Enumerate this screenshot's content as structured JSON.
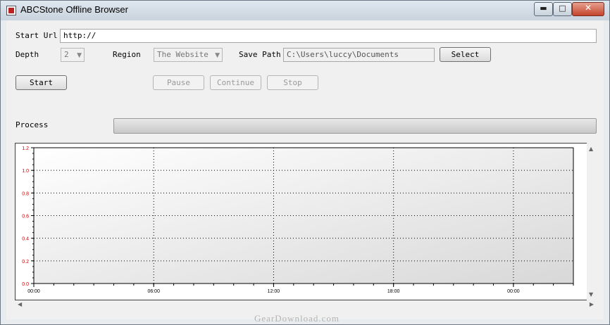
{
  "window": {
    "title": "ABCStone Offline Browser",
    "minimize": "▬",
    "maximize": "□",
    "close": "✕"
  },
  "form": {
    "start_url_label": "Start Url",
    "start_url_value": "http://",
    "depth_label": "Depth",
    "depth_value": "2",
    "region_label": "Region",
    "region_value": "The Website",
    "save_path_label": "Save Path",
    "save_path_value": "C:\\Users\\luccy\\Documents",
    "select_button": "Select"
  },
  "controls": {
    "start": "Start",
    "pause": "Pause",
    "continue": "Continue",
    "stop": "Stop"
  },
  "process_label": "Process",
  "progress": 0,
  "chart_data": {
    "type": "line",
    "x_ticks": [
      "00:00",
      "06:00",
      "12:00",
      "18:00",
      "00:00"
    ],
    "y_ticks": [
      "0.0",
      "0.2",
      "0.4",
      "0.6",
      "0.8",
      "1.0",
      "1.2"
    ],
    "ylim": [
      0,
      1.2
    ],
    "grid": true,
    "series": [],
    "colors": {
      "y_tick_label": "#cc0000",
      "plot_bg_from": "#ffffff",
      "plot_bg_to": "#d8d8d8"
    }
  },
  "watermark": "GearDownload.com"
}
